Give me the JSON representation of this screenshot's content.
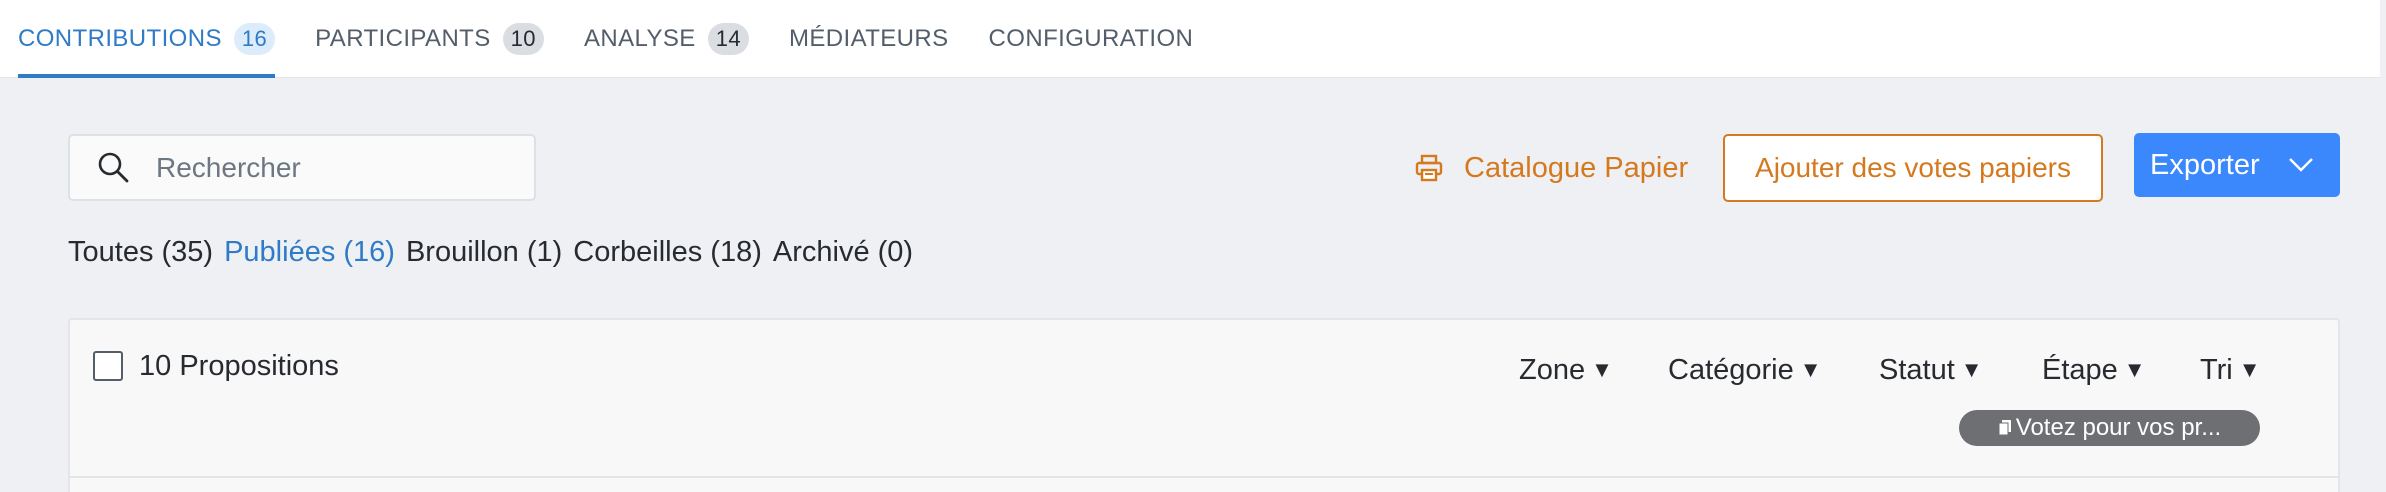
{
  "tabs": [
    {
      "label": "CONTRIBUTIONS",
      "count": "16",
      "active": true
    },
    {
      "label": "PARTICIPANTS",
      "count": "10"
    },
    {
      "label": "ANALYSE",
      "count": "14"
    },
    {
      "label": "MÉDIATEURS"
    },
    {
      "label": "CONFIGURATION"
    }
  ],
  "search": {
    "placeholder": "Rechercher",
    "icon": "search-icon"
  },
  "toolbar": {
    "catalogue_label": "Catalogue Papier",
    "catalogue_icon": "printer-icon",
    "votes_label": "Ajouter des votes papiers",
    "export_label": "Exporter",
    "export_icon": "chevron-down-icon"
  },
  "filters": [
    {
      "label": "Toutes (35)"
    },
    {
      "label": "Publiées (16)",
      "active": true
    },
    {
      "label": "Brouillon (1)"
    },
    {
      "label": "Corbeilles (18)"
    },
    {
      "label": "Archivé (0)"
    }
  ],
  "list": {
    "count_label": "10 Propositions",
    "dropdowns": [
      "Zone",
      "Catégorie",
      "Statut",
      "Étape",
      "Tri"
    ],
    "chip_label": "Votez pour vos pr..."
  },
  "colors": {
    "accent": "#2f7bc7",
    "orange": "#d5791f",
    "primary_button": "#3b88fd",
    "background": "#eef0f4"
  }
}
